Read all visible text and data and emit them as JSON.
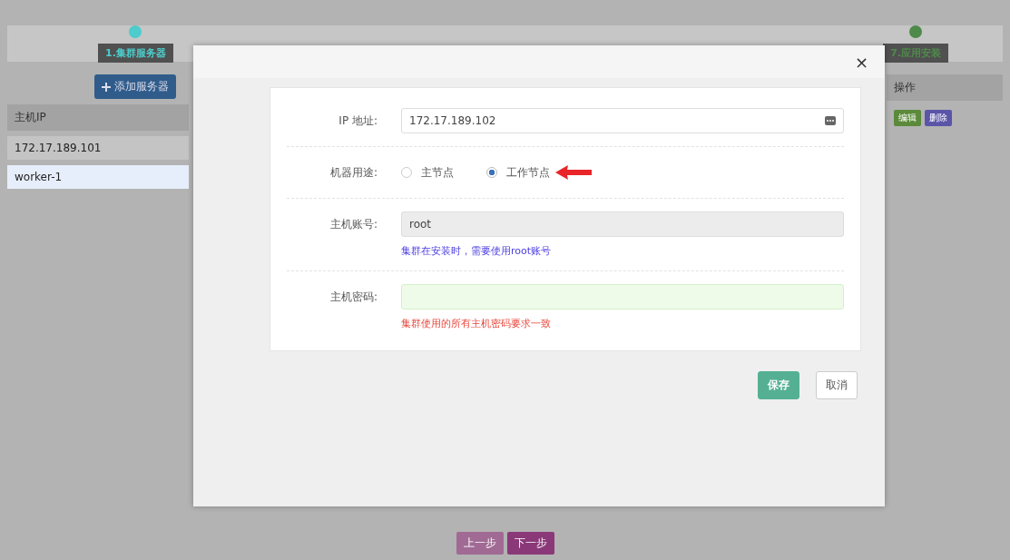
{
  "page": {
    "steps": [
      {
        "label": "1.集群服务器",
        "color": "#4ecbcb"
      },
      {
        "label": "7.应用安装",
        "color": "#4e8a4a"
      }
    ],
    "add_button": "添加服务器",
    "table": {
      "columns": [
        "主机IP",
        "操作"
      ],
      "rows": [
        {
          "host": "172.17.189.101",
          "actions": [
            "编辑",
            "删除"
          ],
          "selected": false
        },
        {
          "host": "worker-1",
          "actions": [],
          "selected": true
        }
      ]
    },
    "nav_buttons": [
      "上一步",
      "下一步"
    ]
  },
  "dialog": {
    "close": "×",
    "fields": [
      {
        "kind": "text",
        "label": "IP 地址:",
        "value": "172.17.189.102",
        "disabled": false
      },
      {
        "kind": "radio",
        "label": "机器用途:",
        "options": [
          {
            "label": "主节点",
            "selected": false
          },
          {
            "label": "工作节点",
            "selected": true
          }
        ]
      },
      {
        "kind": "text",
        "label": "主机账号:",
        "value": "root",
        "disabled": true,
        "hint": {
          "text": "集群在安装时，需要使用root账号",
          "color": "#4b3ee0"
        }
      },
      {
        "kind": "password",
        "label": "主机密码:",
        "valid": true,
        "hint": {
          "text": "集群使用的所有主机密码要求一致",
          "color": "#e8463a"
        }
      }
    ],
    "buttons": [
      {
        "label": "保存",
        "kind": "primary"
      },
      {
        "label": "取消",
        "kind": "default"
      }
    ]
  }
}
